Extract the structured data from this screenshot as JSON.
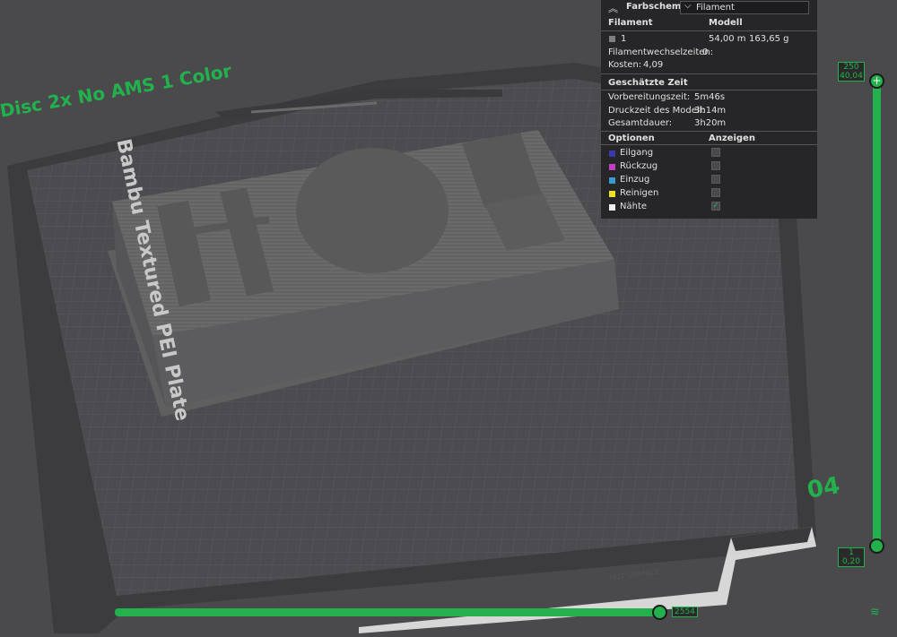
{
  "plate": {
    "name": "Bambu Textured PEI Plate",
    "preset": "Disc 2x No AMS 1 Color",
    "number": "04",
    "model_text": "HORI"
  },
  "legend": {
    "scheme_label": "Farbschema",
    "scheme_value": "Filament",
    "col_filament": "Filament",
    "col_model": "Modell",
    "filament_index": "1",
    "filament_length": "54,00 m",
    "filament_weight": "163,65 g",
    "filament_color": "#808080",
    "changes_label": "Filamentwechselzeiten:",
    "changes_value": "0",
    "cost_label": "Kosten:",
    "cost_value": "4,09",
    "time_header": "Geschätzte Zeit",
    "prep_label": "Vorbereitungszeit:",
    "prep_value": "5m46s",
    "model_time_label": "Druckzeit des Modell:",
    "model_time_value": "3h14m",
    "total_label": "Gesamtdauer:",
    "total_value": "3h20m",
    "options_header": "Optionen",
    "show_header": "Anzeigen",
    "options": [
      {
        "label": "Eilgang",
        "color": "#3a3aa8",
        "checked": false
      },
      {
        "label": "Rückzug",
        "color": "#c040c0",
        "checked": false
      },
      {
        "label": "Einzug",
        "color": "#3a9ad0",
        "checked": false
      },
      {
        "label": "Reinigen",
        "color": "#f0e020",
        "checked": false
      },
      {
        "label": "Nähte",
        "color": "#f0f0f0",
        "checked": true
      }
    ]
  },
  "vslider": {
    "top_layer": "250",
    "top_height": "40,04",
    "bottom_layer": "1",
    "bottom_height": "0,20",
    "add_symbol": "+"
  },
  "hslider": {
    "value": "2554"
  },
  "icons": {
    "collapse": "double-chevron-up-icon",
    "dropdown": "chevron-down-icon",
    "layers": "layers-icon"
  },
  "colors": {
    "accent": "#22b14c",
    "panel_bg": "#262628",
    "viewport_bg": "#4a4a4d"
  }
}
